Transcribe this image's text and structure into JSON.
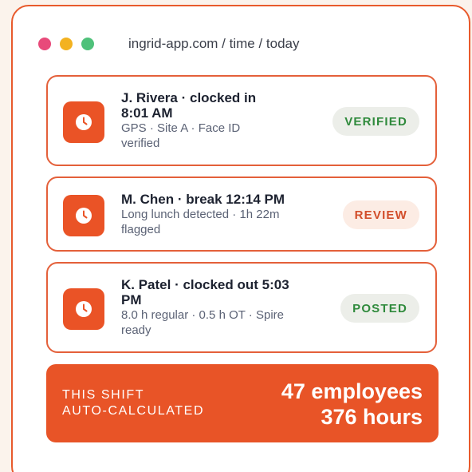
{
  "window": {
    "dots": [
      {
        "name": "close",
        "color": "#e84a7a"
      },
      {
        "name": "minimize",
        "color": "#f3b220"
      },
      {
        "name": "maximize",
        "color": "#4fc17a"
      }
    ],
    "url": "ingrid-app.com / time / today"
  },
  "cards": [
    {
      "icon": "clock-icon",
      "title": "J. Rivera · clocked in 8:01 AM",
      "title_line1": "J. Rivera · clocked in",
      "title_line2": "8:01 AM",
      "sub_line1": "GPS · Site A · Face ID",
      "sub_line2": "verified",
      "badge": "VERIFIED"
    },
    {
      "icon": "clock-icon",
      "title_line1": "M. Chen · break 12:14 PM",
      "sub_line1": "Long lunch detected · 1h 22m",
      "sub_line2": "flagged",
      "badge": "REVIEW"
    },
    {
      "icon": "clock-icon",
      "title_line1": "K. Patel · clocked out 5:03",
      "title_line2": "PM",
      "sub_line1": "8.0 h regular · 0.5 h OT · Spire",
      "sub_line2": "ready",
      "badge": "POSTED"
    }
  ],
  "summary": {
    "label_line1": "THIS SHIFT",
    "label_line2": "AUTO-CALCULATED",
    "employees": "47 employees",
    "hours": "376 hours"
  },
  "colors": {
    "accent": "#e85427",
    "verified": "#2f8a3c",
    "review": "#d24e2b"
  }
}
